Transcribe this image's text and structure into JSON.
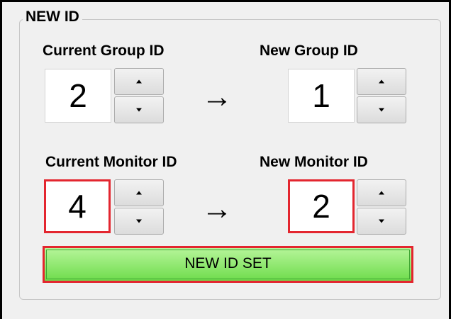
{
  "panel": {
    "title": "NEW ID"
  },
  "group": {
    "current_label": "Current Group ID",
    "current_value": "2",
    "new_label": "New Group ID",
    "new_value": "1",
    "arrow": "→"
  },
  "monitor": {
    "current_label": "Current Monitor ID",
    "current_value": "4",
    "new_label": "New Monitor ID",
    "new_value": "2",
    "arrow": "→"
  },
  "actions": {
    "set_label": "NEW ID SET"
  },
  "colors": {
    "highlight": "#e3262f",
    "button_green": "#6fdc4c"
  }
}
